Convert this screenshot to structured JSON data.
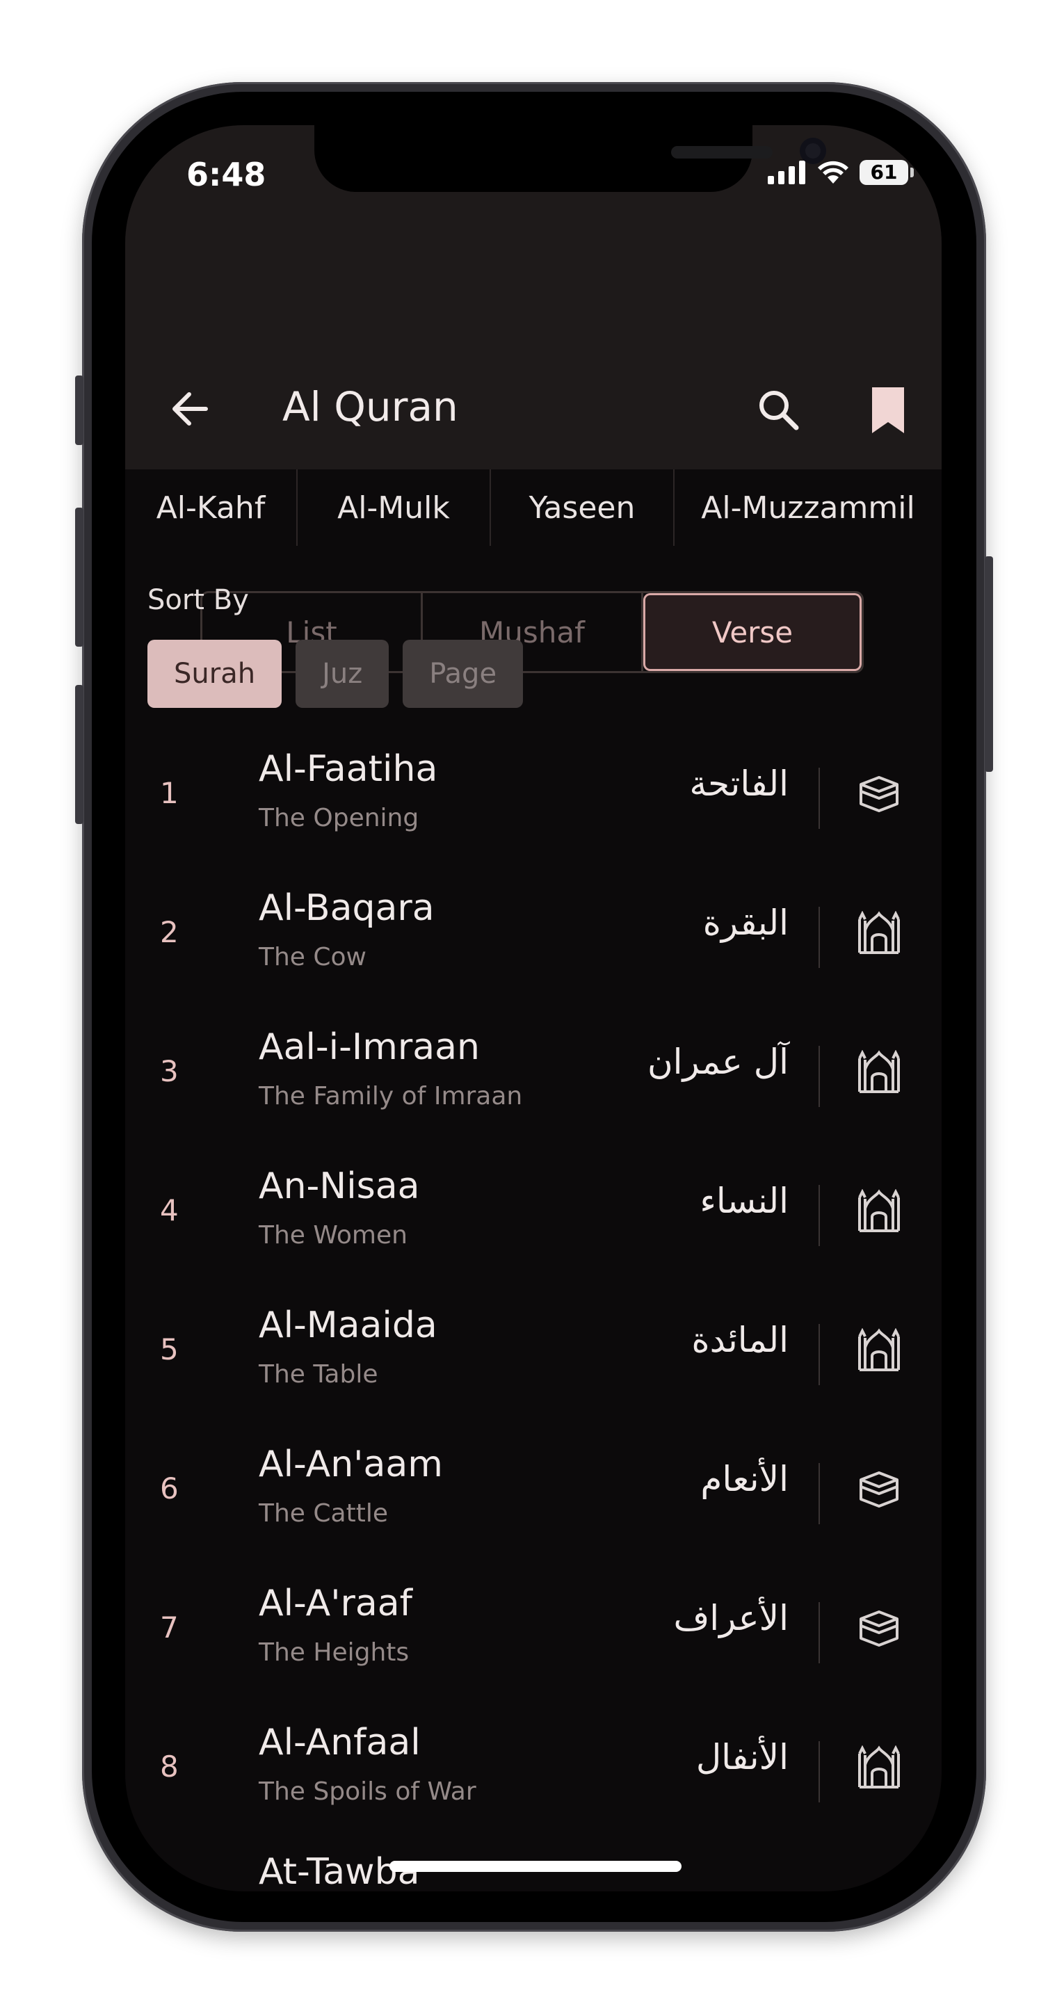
{
  "status_bar": {
    "time": "6:48",
    "battery": "61"
  },
  "appbar": {
    "title": "Al Quran"
  },
  "quick_tabs": [
    "Al-Kahf",
    "Al-Mulk",
    "Yaseen",
    "Al-Muzzammil"
  ],
  "view_modes": [
    {
      "label": "List",
      "active": false
    },
    {
      "label": "Mushaf",
      "active": false
    },
    {
      "label": "Verse",
      "active": true
    }
  ],
  "sort": {
    "label": "Sort By",
    "options": [
      {
        "label": "Surah",
        "active": true
      },
      {
        "label": "Juz",
        "active": false
      },
      {
        "label": "Page",
        "active": false
      }
    ]
  },
  "surahs": [
    {
      "number": "1",
      "name": "Al-Faatiha",
      "meaning": "The Opening",
      "arabic": "الفاتحة",
      "place_icon": "kaaba-icon"
    },
    {
      "number": "2",
      "name": "Al-Baqara",
      "meaning": "The Cow",
      "arabic": "البقرة",
      "place_icon": "mosque-icon"
    },
    {
      "number": "3",
      "name": "Aal-i-Imraan",
      "meaning": "The Family of Imraan",
      "arabic": "آل عمران",
      "place_icon": "mosque-icon"
    },
    {
      "number": "4",
      "name": "An-Nisaa",
      "meaning": "The Women",
      "arabic": "النساء",
      "place_icon": "mosque-icon"
    },
    {
      "number": "5",
      "name": "Al-Maaida",
      "meaning": "The Table",
      "arabic": "المائدة",
      "place_icon": "mosque-icon"
    },
    {
      "number": "6",
      "name": "Al-An'aam",
      "meaning": "The Cattle",
      "arabic": "الأنعام",
      "place_icon": "kaaba-icon"
    },
    {
      "number": "7",
      "name": "Al-A'raaf",
      "meaning": "The Heights",
      "arabic": "الأعراف",
      "place_icon": "kaaba-icon"
    },
    {
      "number": "8",
      "name": "Al-Anfaal",
      "meaning": "The Spoils of War",
      "arabic": "الأنفال",
      "place_icon": "mosque-icon"
    }
  ],
  "partial_row": {
    "name": "At-Tawba"
  },
  "colors": {
    "accent": "#dcbcbb",
    "background": "#0c0a0b",
    "appbar": "#1e1a1a"
  }
}
